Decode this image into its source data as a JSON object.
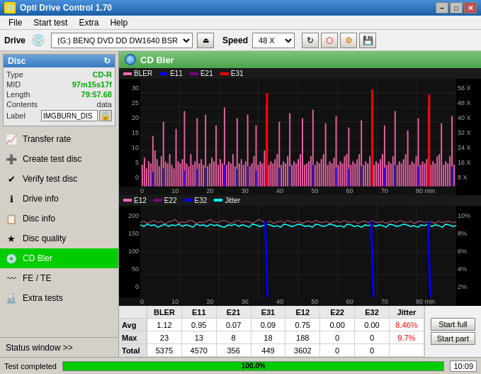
{
  "titleBar": {
    "icon": "💿",
    "title": "Opti Drive Control 1.70",
    "minimizeLabel": "–",
    "maximizeLabel": "□",
    "closeLabel": "✕"
  },
  "menuBar": {
    "items": [
      "File",
      "Start test",
      "Extra",
      "Help"
    ]
  },
  "driveBar": {
    "driveLabel": "Drive",
    "driveValue": "(G:)  BENQ DVD DD DW1640 BSRB",
    "speedLabel": "Speed",
    "speedValue": "48 X",
    "refreshIcon": "↻",
    "ejectIcon": "⏏",
    "settingsIcon": "⚙",
    "saveIcon": "💾"
  },
  "disc": {
    "header": "Disc",
    "refreshIcon": "↻",
    "typeLabel": "Type",
    "typeValue": "CD-R",
    "midLabel": "MID",
    "midValue": "97m15s17f",
    "lengthLabel": "Length",
    "lengthValue": "79:57.68",
    "contentsLabel": "Contents",
    "contentsValue": "data",
    "labelLabel": "Label",
    "labelValue": "IMGBURN_DIS",
    "labelBtnIcon": "🔒"
  },
  "navItems": [
    {
      "id": "transfer-rate",
      "icon": "📈",
      "label": "Transfer rate",
      "active": false
    },
    {
      "id": "create-test-disc",
      "icon": "➕",
      "label": "Create test disc",
      "active": false
    },
    {
      "id": "verify-test-disc",
      "icon": "✔",
      "label": "Verify test disc",
      "active": false
    },
    {
      "id": "drive-info",
      "icon": "ℹ",
      "label": "Drive info",
      "active": false
    },
    {
      "id": "disc-info",
      "icon": "📋",
      "label": "Disc info",
      "active": false
    },
    {
      "id": "disc-quality",
      "icon": "★",
      "label": "Disc quality",
      "active": false
    },
    {
      "id": "cd-bler",
      "icon": "💿",
      "label": "CD Bler",
      "active": true
    },
    {
      "id": "fe-te",
      "icon": "〰",
      "label": "FE / TE",
      "active": false
    },
    {
      "id": "extra-tests",
      "icon": "🔬",
      "label": "Extra tests",
      "active": false
    }
  ],
  "statusWindow": "Status window >>",
  "chartHeader": {
    "icon": "disc",
    "title": "CD Bler"
  },
  "upperChart": {
    "legend": [
      {
        "color": "#ff69b4",
        "label": "BLER"
      },
      {
        "color": "#0000ff",
        "label": "E11"
      },
      {
        "color": "#800080",
        "label": "E21"
      },
      {
        "color": "#ff0000",
        "label": "E31"
      }
    ],
    "yAxisMax": 56,
    "yAxisLabels": [
      "56 X",
      "48 X",
      "40 X",
      "32 X",
      "24 X",
      "16 X",
      "8 X"
    ],
    "xAxisLabels": [
      "0",
      "10",
      "20",
      "30",
      "40",
      "50",
      "60",
      "70",
      "80 min"
    ]
  },
  "lowerChart": {
    "legend": [
      {
        "color": "#ff69b4",
        "label": "E12"
      },
      {
        "color": "#800080",
        "label": "E22"
      },
      {
        "color": "#0000ff",
        "label": "E32"
      },
      {
        "color": "#00ffff",
        "label": "Jitter"
      }
    ],
    "yAxisLabels": [
      "10%",
      "8%",
      "6%",
      "4%",
      "2%"
    ],
    "xAxisLabels": [
      "0",
      "10",
      "20",
      "30",
      "40",
      "50",
      "60",
      "70",
      "80 min"
    ]
  },
  "statsTable": {
    "headers": [
      "",
      "BLER",
      "E11",
      "E21",
      "E31",
      "E12",
      "E22",
      "E32",
      "Jitter"
    ],
    "rows": [
      {
        "label": "Avg",
        "values": [
          "1.12",
          "0.95",
          "0.07",
          "0.09",
          "0.75",
          "0.00",
          "0.00",
          "8.46%"
        ]
      },
      {
        "label": "Max",
        "values": [
          "23",
          "13",
          "8",
          "18",
          "188",
          "0",
          "0",
          "9.7%"
        ]
      },
      {
        "label": "Total",
        "values": [
          "5375",
          "4570",
          "356",
          "449",
          "3602",
          "0",
          "0",
          ""
        ]
      }
    ],
    "startFullLabel": "Start full",
    "startPartLabel": "Start part"
  },
  "statusBar": {
    "text": "Test completed",
    "progress": 100,
    "progressLabel": "100.0%",
    "time": "10:09"
  }
}
